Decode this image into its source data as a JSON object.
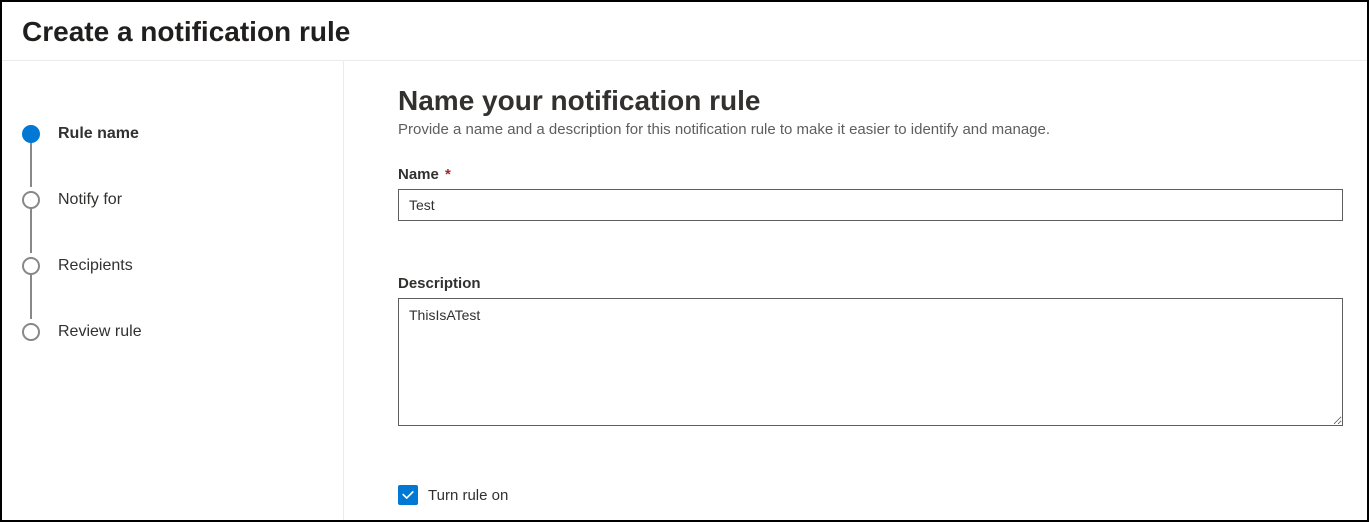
{
  "header": {
    "title": "Create a notification rule"
  },
  "sidebar": {
    "steps": [
      {
        "label": "Rule name",
        "active": true
      },
      {
        "label": "Notify for",
        "active": false
      },
      {
        "label": "Recipients",
        "active": false
      },
      {
        "label": "Review rule",
        "active": false
      }
    ]
  },
  "main": {
    "heading": "Name your notification rule",
    "subtitle": "Provide a name and a description for this notification rule to make it easier to identify and manage.",
    "name_field": {
      "label": "Name",
      "required_marker": "*",
      "value": "Test"
    },
    "description_field": {
      "label": "Description",
      "value": "ThisIsATest"
    },
    "toggle": {
      "label": "Turn rule on",
      "checked": true
    }
  },
  "colors": {
    "accent": "#0078d4",
    "border": "#605e5c",
    "text": "#323130",
    "subtext": "#605e5c",
    "required": "#a4262c"
  }
}
